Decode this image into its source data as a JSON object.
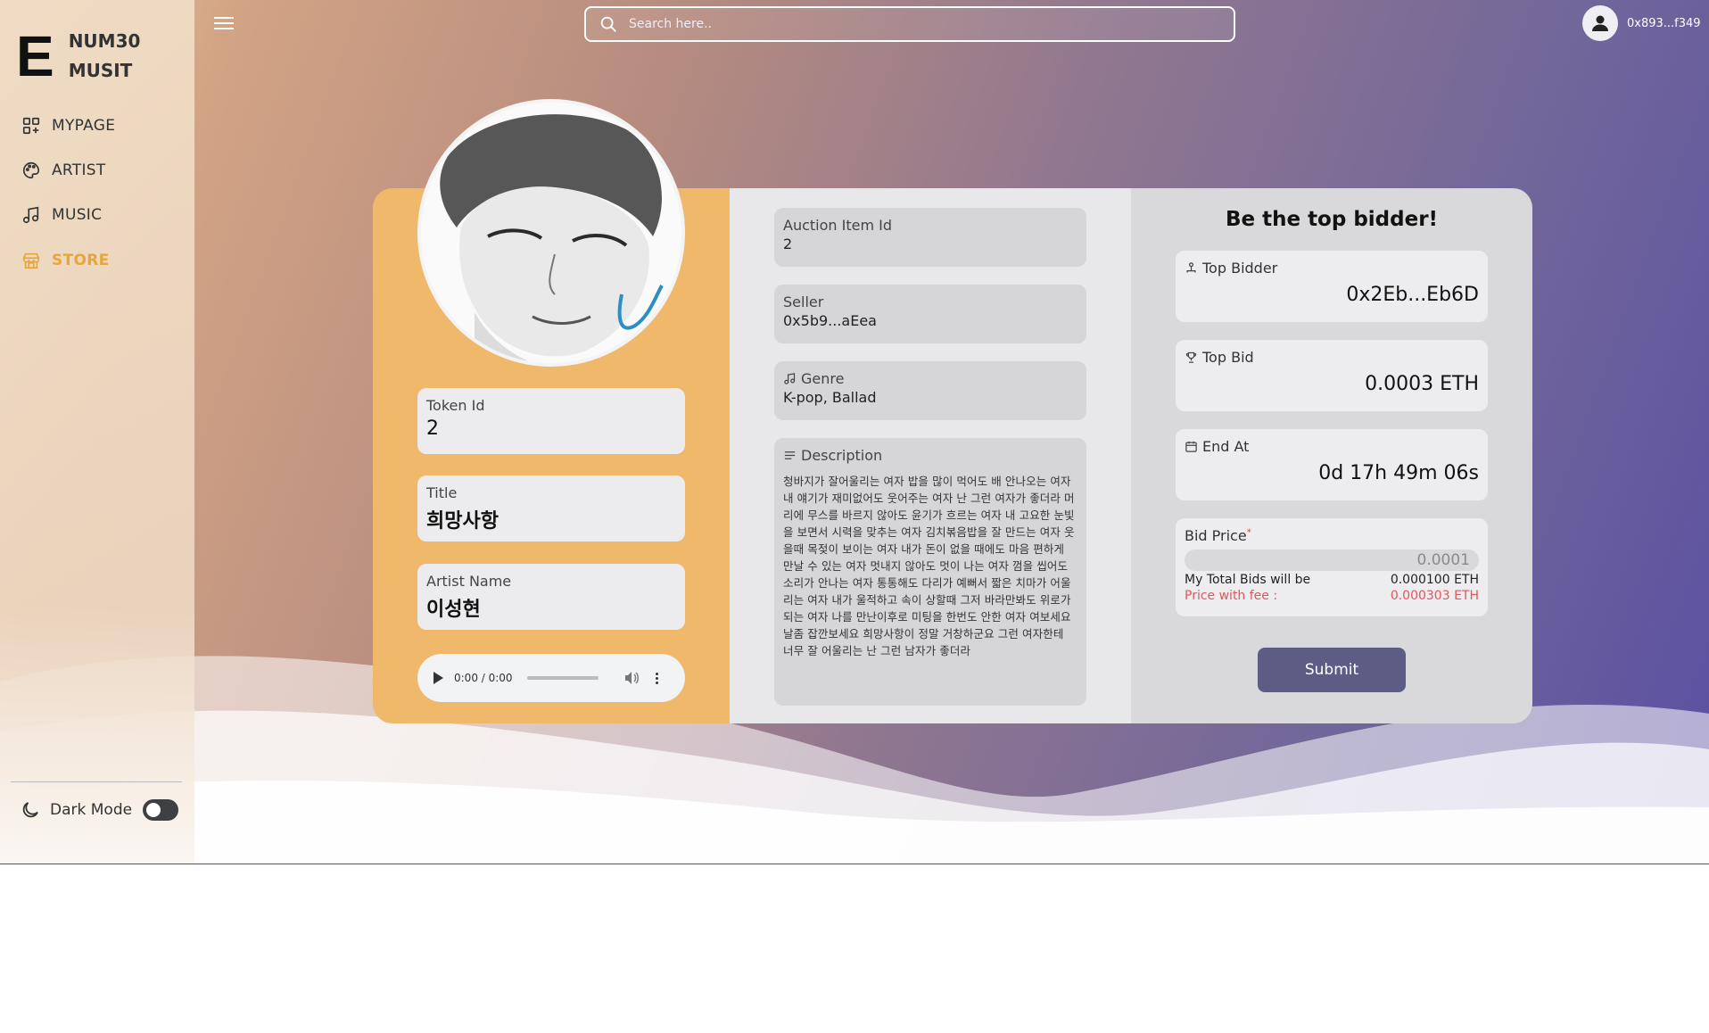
{
  "brand": {
    "mark": "E",
    "name_line1": "NUM30",
    "name_line2": "MUSIT"
  },
  "sidebar": {
    "items": [
      {
        "label": "MYPAGE",
        "icon": "dashboard-icon",
        "active": false
      },
      {
        "label": "ARTIST",
        "icon": "palette-icon",
        "active": false
      },
      {
        "label": "MUSIC",
        "icon": "music-note-icon",
        "active": false
      },
      {
        "label": "STORE",
        "icon": "store-icon",
        "active": true
      }
    ],
    "dark_mode": {
      "label": "Dark Mode",
      "enabled": false,
      "icon": "moon-icon"
    }
  },
  "topbar": {
    "search_placeholder": "Search here..",
    "wallet_address": "0x893...f349"
  },
  "colors": {
    "accent_active": "#e7a63b",
    "card_left": "#f0b86b",
    "submit_button": "#5d5c84",
    "fee_text": "#e0565d"
  },
  "item": {
    "token_id_label": "Token Id",
    "token_id": "2",
    "title_label": "Title",
    "title": "희망사항",
    "artist_label": "Artist Name",
    "artist": "이성현",
    "audio_time": "0:00 / 0:00",
    "auction_item_id_label": "Auction Item Id",
    "auction_item_id": "2",
    "seller_label": "Seller",
    "seller": "0x5b9...aEea",
    "genre_label": "Genre",
    "genre": "K-pop, Ballad",
    "description_label": "Description",
    "description": "청바지가 잘어울리는 여자 밥을 많이 먹어도 배 안나오는 여자 내 얘기가 재미없어도 웃어주는 여자 난 그런 여자가 좋더라 머리에 무스를 바르지 않아도 윤기가 흐르는 여자 내 고요한 눈빛을 보면서 시력을 맞추는 여자 김치볶음밥을 잘 만드는 여자 웃을때 목젖이 보이는 여자 내가 돈이 없을 때에도 마음 편하게 만날 수 있는 여자 멋내지 않아도 멋이 나는 여자 껌을 씹어도 소리가 안나는 여자 통통해도 다리가 예뻐서 짧은 치마가 어울리는 여자 내가 울적하고 속이 상할때 그저 바라만봐도 위로가 되는 여자 나를 만난이후로 미팅을 한번도 안한 여자 여보세요 날좀 잡깐보세요 희망사항이 정말 거창하군요 그런 여자한테 너무 잘 어울리는 난 그런 남자가 좋더라"
  },
  "bid": {
    "heading": "Be the top bidder!",
    "top_bidder_label": "Top Bidder",
    "top_bidder": "0x2Eb...Eb6D",
    "top_bid_label": "Top Bid",
    "top_bid": "0.0003 ETH",
    "end_at_label": "End At",
    "end_at": "0d 17h 49m 06s",
    "bid_price_label": "Bid Price",
    "bid_price_required_mark": "*",
    "bid_price_value": "0.0001",
    "total_bids_label": "My Total Bids will be",
    "total_bids_value": "0.000100 ETH",
    "fee_label": "Price with fee :",
    "fee_value": "0.000303 ETH",
    "submit_label": "Submit"
  }
}
